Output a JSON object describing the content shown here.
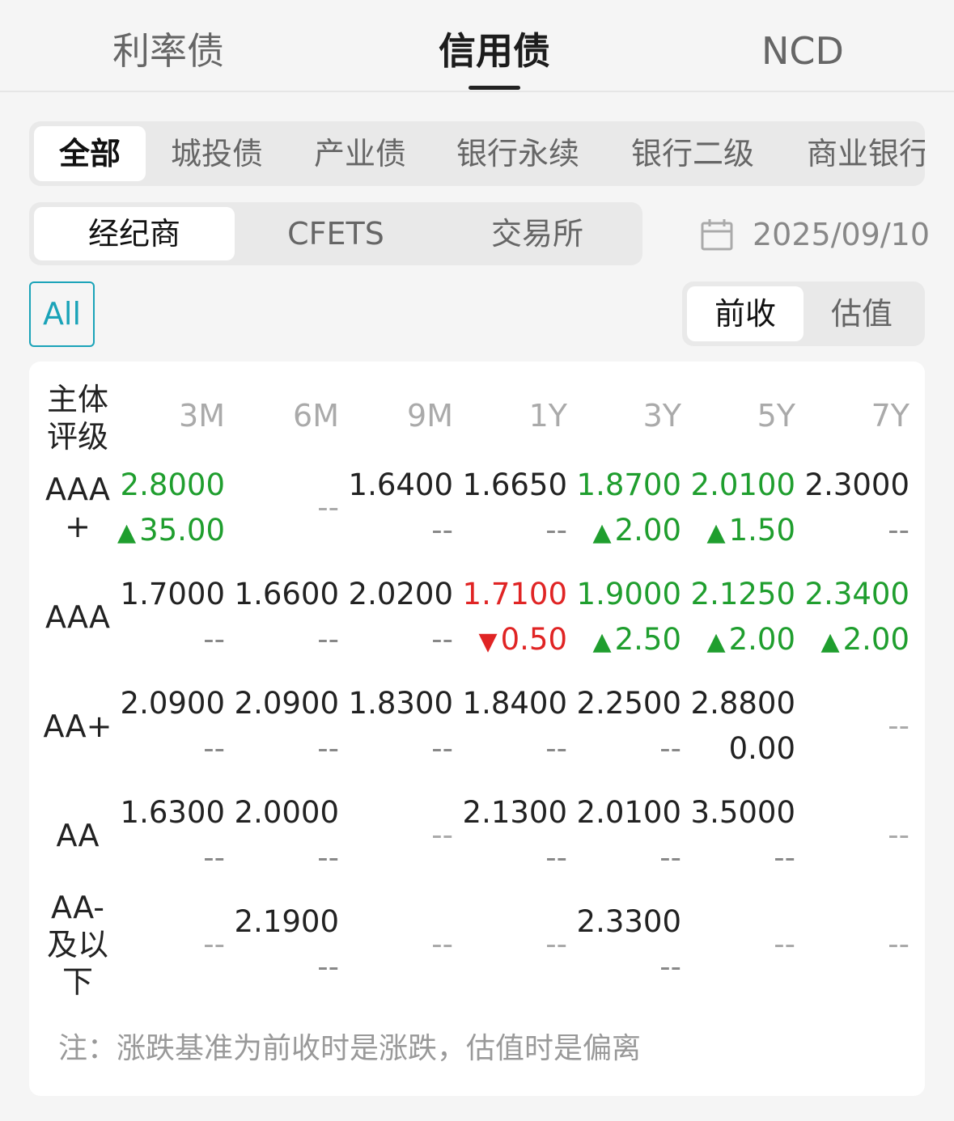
{
  "top_tabs": [
    "利率债",
    "信用债",
    "NCD"
  ],
  "categories": [
    "全部",
    "城投债",
    "产业债",
    "银行永续",
    "银行二级",
    "商业银行"
  ],
  "sources": [
    "经纪商",
    "CFETS",
    "交易所"
  ],
  "date": "2025/09/10",
  "filter_all": "All",
  "modes": [
    "前收",
    "估值"
  ],
  "table": {
    "rating_header": "主体评级",
    "rating_header_lines": [
      "主体",
      "评级"
    ],
    "columns": [
      "3M",
      "6M",
      "9M",
      "1Y",
      "3Y",
      "5Y",
      "7Y"
    ],
    "rows": [
      {
        "label_lines": [
          "AAA",
          "+"
        ],
        "cells": [
          {
            "value": "2.8000",
            "change": "35.00",
            "dir": "up"
          },
          {
            "value": "",
            "change": "--",
            "dir": "none"
          },
          {
            "value": "1.6400",
            "change": "--",
            "dir": "none"
          },
          {
            "value": "1.6650",
            "change": "--",
            "dir": "none"
          },
          {
            "value": "1.8700",
            "change": "2.00",
            "dir": "up"
          },
          {
            "value": "2.0100",
            "change": "1.50",
            "dir": "up"
          },
          {
            "value": "2.3000",
            "change": "--",
            "dir": "none"
          }
        ]
      },
      {
        "label_lines": [
          "AAA"
        ],
        "cells": [
          {
            "value": "1.7000",
            "change": "--",
            "dir": "none"
          },
          {
            "value": "1.6600",
            "change": "--",
            "dir": "none"
          },
          {
            "value": "2.0200",
            "change": "--",
            "dir": "none"
          },
          {
            "value": "1.7100",
            "change": "0.50",
            "dir": "down"
          },
          {
            "value": "1.9000",
            "change": "2.50",
            "dir": "up"
          },
          {
            "value": "2.1250",
            "change": "2.00",
            "dir": "up"
          },
          {
            "value": "2.3400",
            "change": "2.00",
            "dir": "up"
          }
        ]
      },
      {
        "label_lines": [
          "AA+"
        ],
        "cells": [
          {
            "value": "2.0900",
            "change": "--",
            "dir": "none"
          },
          {
            "value": "2.0900",
            "change": "--",
            "dir": "none"
          },
          {
            "value": "1.8300",
            "change": "--",
            "dir": "none"
          },
          {
            "value": "1.8400",
            "change": "--",
            "dir": "none"
          },
          {
            "value": "2.2500",
            "change": "--",
            "dir": "none"
          },
          {
            "value": "2.8800",
            "change": "0.00",
            "dir": "flat"
          },
          {
            "value": "",
            "change": "--",
            "dir": "none"
          }
        ]
      },
      {
        "label_lines": [
          "AA"
        ],
        "cells": [
          {
            "value": "1.6300",
            "change": "--",
            "dir": "none"
          },
          {
            "value": "2.0000",
            "change": "--",
            "dir": "none"
          },
          {
            "value": "",
            "change": "--",
            "dir": "none"
          },
          {
            "value": "2.1300",
            "change": "--",
            "dir": "none"
          },
          {
            "value": "2.0100",
            "change": "--",
            "dir": "none"
          },
          {
            "value": "3.5000",
            "change": "--",
            "dir": "none"
          },
          {
            "value": "",
            "change": "--",
            "dir": "none"
          }
        ]
      },
      {
        "label_lines": [
          "AA-",
          "及以",
          "下"
        ],
        "cells": [
          {
            "value": "",
            "change": "--",
            "dir": "none"
          },
          {
            "value": "2.1900",
            "change": "--",
            "dir": "none"
          },
          {
            "value": "",
            "change": "--",
            "dir": "none"
          },
          {
            "value": "",
            "change": "--",
            "dir": "none"
          },
          {
            "value": "2.3300",
            "change": "--",
            "dir": "none"
          },
          {
            "value": "",
            "change": "--",
            "dir": "none"
          },
          {
            "value": "",
            "change": "--",
            "dir": "none"
          }
        ]
      }
    ]
  },
  "note": "注：涨跌基准为前收时是涨跌，估值时是偏离",
  "colors": {
    "up": "#1f9e2e",
    "down": "#e02424",
    "accent": "#1aa3b8"
  },
  "icons": {
    "up": "▲",
    "down": "▼",
    "date": "calendar-icon"
  }
}
